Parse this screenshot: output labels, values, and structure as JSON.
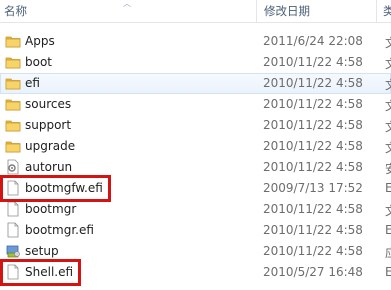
{
  "header": {
    "col_name": "名称",
    "col_date": "修改日期",
    "col_type": "类"
  },
  "files": [
    {
      "name": "Apps",
      "date": "2011/6/24 22:08",
      "type": "文",
      "icon": "folder-icon"
    },
    {
      "name": "boot",
      "date": "2010/11/22 4:58",
      "type": "文",
      "icon": "folder-icon"
    },
    {
      "name": "efi",
      "date": "2010/11/22 4:58",
      "type": "文",
      "icon": "folder-icon",
      "selected": true
    },
    {
      "name": "sources",
      "date": "2010/11/22 4:58",
      "type": "文",
      "icon": "folder-icon"
    },
    {
      "name": "support",
      "date": "2010/11/22 4:58",
      "type": "文",
      "icon": "folder-icon"
    },
    {
      "name": "upgrade",
      "date": "2010/11/22 4:58",
      "type": "文",
      "icon": "folder-icon"
    },
    {
      "name": "autorun",
      "date": "2010/11/22 4:58",
      "type": "安",
      "icon": "setup-info-icon"
    },
    {
      "name": "bootmgfw.efi",
      "date": "2009/7/13 17:52",
      "type": "E",
      "icon": "file-icon",
      "highlighted": true
    },
    {
      "name": "bootmgr",
      "date": "2010/11/22 4:58",
      "type": "文",
      "icon": "file-icon"
    },
    {
      "name": "bootmgr.efi",
      "date": "2010/11/22 4:58",
      "type": "E",
      "icon": "file-icon"
    },
    {
      "name": "setup",
      "date": "2010/11/22 4:58",
      "type": "应",
      "icon": "installer-icon"
    },
    {
      "name": "Shell.efi",
      "date": "2010/5/27 16:48",
      "type": "E",
      "icon": "file-icon",
      "highlighted": true
    }
  ],
  "colors": {
    "highlight_border": "#d41313",
    "folder": "#e8b73f",
    "selection": "#e9f2fc"
  }
}
